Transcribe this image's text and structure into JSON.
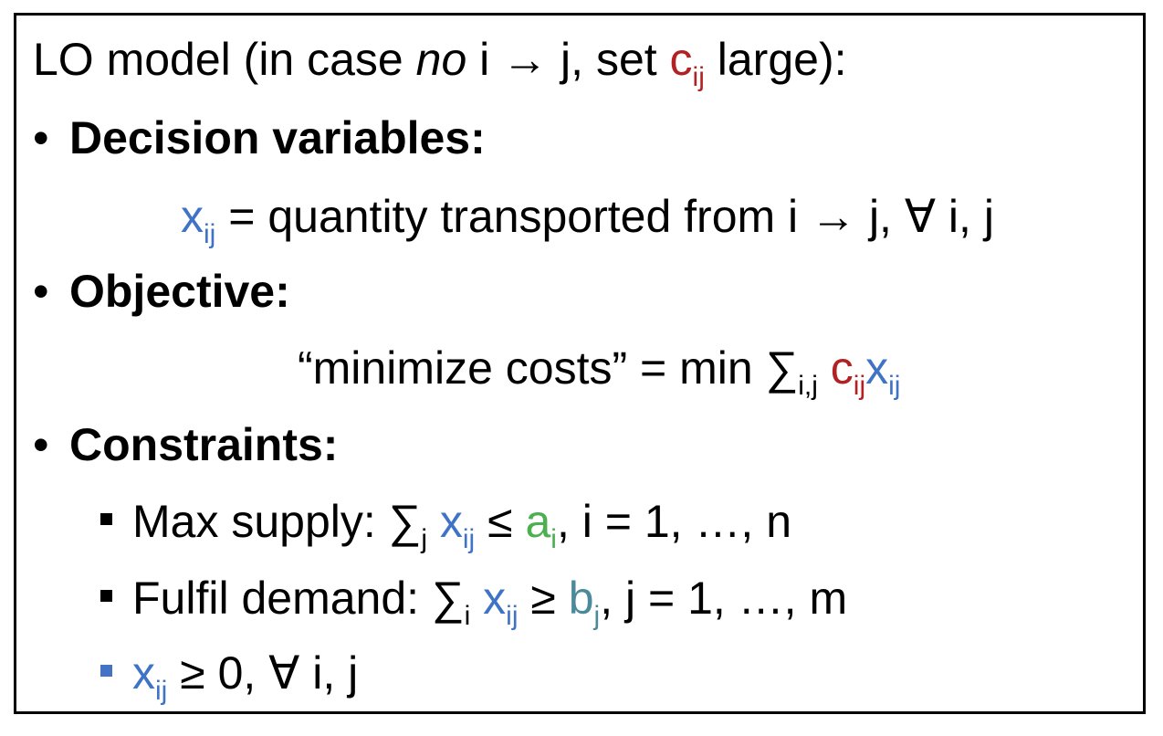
{
  "heading": {
    "prefix": "LO model (in case ",
    "italic": "no",
    "middle": " i → j, set ",
    "c": "c",
    "c_sub": "ij",
    "suffix": " large):"
  },
  "bullets": {
    "dot": "•",
    "decision_label": "Decision variables:",
    "objective_label": "Objective:",
    "constraints_label": "Constraints:"
  },
  "decision": {
    "x": "x",
    "x_sub": "ij",
    "text": " = quantity transported from i → j, ∀ i, j"
  },
  "objective": {
    "text": "“minimize costs” = min ∑",
    "sum_sub": "i,j",
    "c": " c",
    "c_sub": "ij",
    "x": "x",
    "x_sub": "ij"
  },
  "constraints": {
    "supply": {
      "prefix": "Max supply: ∑",
      "sum_sub": "j",
      "x": " x",
      "x_sub": "ij",
      "rel": " ≤ ",
      "a": "a",
      "a_sub": "i",
      "suffix": ", i = 1, …, n"
    },
    "demand": {
      "prefix": "Fulfil demand: ∑",
      "sum_sub": "i",
      "x": " x",
      "x_sub": "ij",
      "rel": " ≥ ",
      "b": "b",
      "b_sub": "j",
      "suffix": ", j = 1, …, m"
    },
    "nonneg": {
      "x": "x",
      "x_sub": "ij",
      "suffix": " ≥ 0, ∀ i, j"
    }
  },
  "colors": {
    "c_coeff": "#b22222",
    "x_var": "#3f73c6",
    "a_supply": "#4caf50",
    "b_demand": "#4a8a9a",
    "nonneg_bullet": "#4472c4"
  }
}
